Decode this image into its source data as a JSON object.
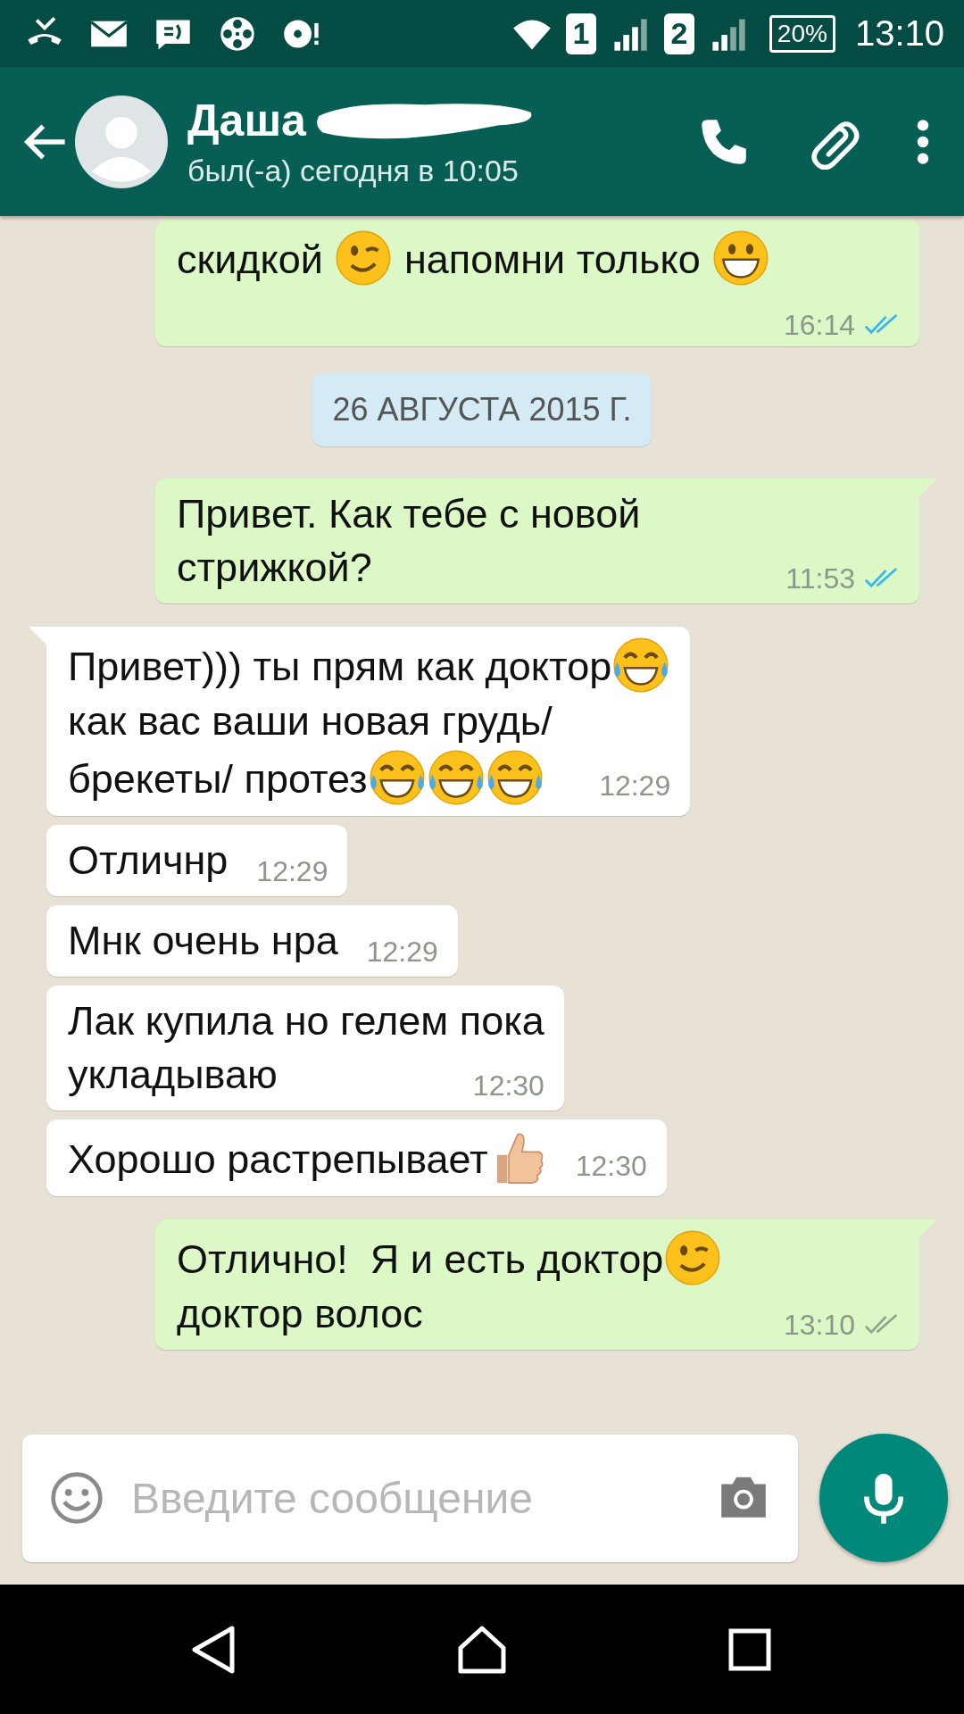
{
  "status_bar": {
    "sims": [
      {
        "label": "1"
      },
      {
        "label": "2"
      }
    ],
    "battery": "20%",
    "time": "13:10"
  },
  "header": {
    "contact_name": "Даша",
    "last_seen": "был(-а) сегодня в 10:05"
  },
  "messages": [
    {
      "kind": "outgoing",
      "tail": false,
      "lines": [
        [
          {
            "kind": "text",
            "text": "скидкой "
          },
          {
            "kind": "winking-emoji"
          },
          {
            "kind": "text",
            "text": " напомни только "
          },
          {
            "kind": "grinning-emoji"
          }
        ]
      ],
      "time": "16:14",
      "seen": true
    },
    {
      "kind": "date",
      "text": "26 АВГУСТА 2015 Г."
    },
    {
      "kind": "outgoing",
      "tail": true,
      "lines": [
        [
          {
            "kind": "text",
            "text": "Привет. Как тебе с новой"
          }
        ],
        [
          {
            "kind": "text",
            "text": "стрижкой?"
          }
        ]
      ],
      "time": "11:53",
      "seen": true
    },
    {
      "kind": "incoming",
      "tail": true,
      "lines": [
        [
          {
            "kind": "text",
            "text": "Привет))) ты прям как доктор"
          },
          {
            "kind": "laughing-emoji"
          }
        ],
        [
          {
            "kind": "text",
            "text": "как вас ваши новая грудь/"
          }
        ],
        [
          {
            "kind": "text",
            "text": "брекеты/ протез"
          },
          {
            "kind": "laughing-emoji"
          },
          {
            "kind": "laughing-emoji"
          },
          {
            "kind": "laughing-emoji"
          }
        ]
      ],
      "time": "12:29"
    },
    {
      "kind": "incoming",
      "tail": false,
      "lines": [
        [
          {
            "kind": "text",
            "text": "Отличнр"
          }
        ]
      ],
      "time": "12:29"
    },
    {
      "kind": "incoming",
      "tail": false,
      "lines": [
        [
          {
            "kind": "text",
            "text": "Мнк очень нра"
          }
        ]
      ],
      "time": "12:29"
    },
    {
      "kind": "incoming",
      "tail": false,
      "lines": [
        [
          {
            "kind": "text",
            "text": "Лак купила но гелем пока"
          }
        ],
        [
          {
            "kind": "text",
            "text": "укладываю"
          }
        ]
      ],
      "time": "12:30"
    },
    {
      "kind": "incoming",
      "tail": false,
      "lines": [
        [
          {
            "kind": "text",
            "text": "Хорошо растрепывает"
          },
          {
            "kind": "thumbs-up-emoji"
          }
        ]
      ],
      "time": "12:30"
    },
    {
      "kind": "outgoing",
      "tail": true,
      "lines": [
        [
          {
            "kind": "text",
            "text": "Отлично!  Я и есть доктор"
          },
          {
            "kind": "winking-emoji"
          }
        ],
        [
          {
            "kind": "text",
            "text": "доктор волос"
          }
        ]
      ],
      "time": "13:10",
      "seen": false
    }
  ],
  "composer": {
    "placeholder": "Введите сообщение"
  }
}
